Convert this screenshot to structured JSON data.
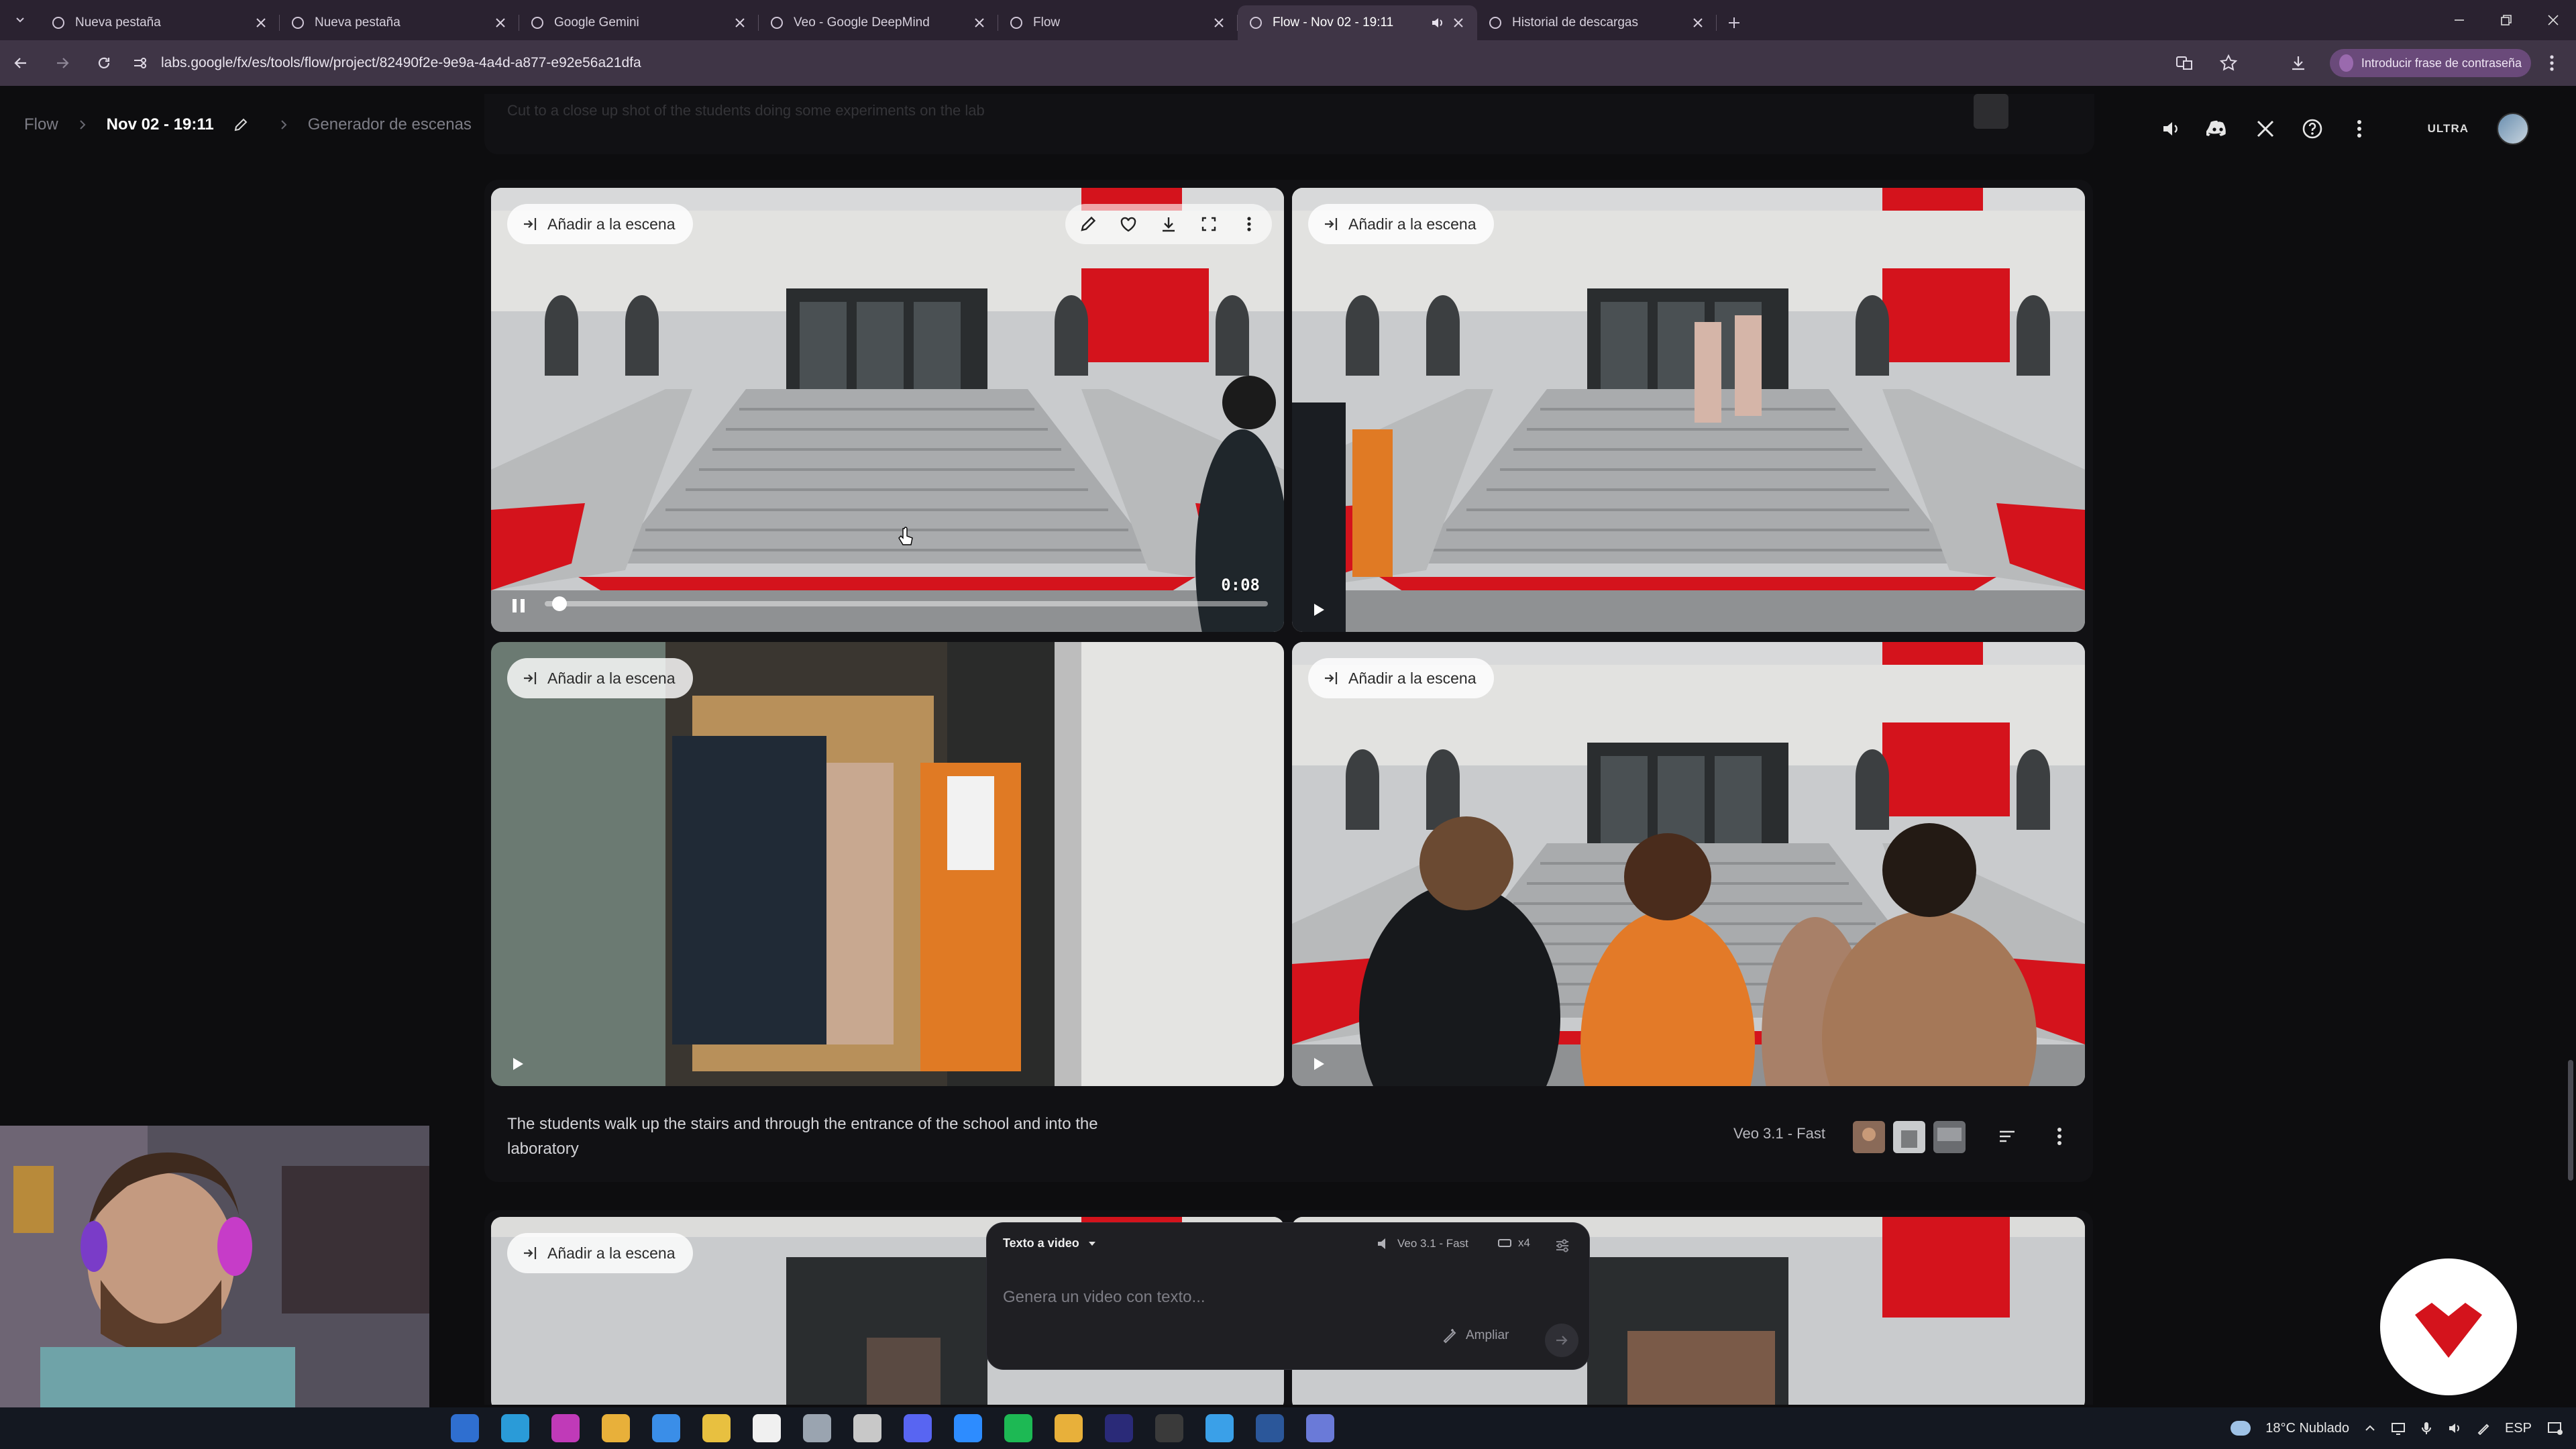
{
  "browser": {
    "tabs": [
      {
        "title": "Nueva pestaña",
        "icon": "globe-icon",
        "active": false
      },
      {
        "title": "Nueva pestaña",
        "icon": "globe-icon",
        "active": false
      },
      {
        "title": "Google Gemini",
        "icon": "gemini-icon",
        "active": false
      },
      {
        "title": "Veo - Google DeepMind",
        "icon": "deepmind-icon",
        "active": false
      },
      {
        "title": "Flow",
        "icon": "flow-icon",
        "active": false
      },
      {
        "title": "Flow - Nov 02 - 19:11",
        "icon": "flow-icon",
        "active": true,
        "audio": true
      },
      {
        "title": "Historial de descargas",
        "icon": "download-icon",
        "active": false
      }
    ],
    "url": "labs.google/fx/es/tools/flow/project/82490f2e-9e9a-4a4d-a877-e92e56a21dfa",
    "password_chip": "Introducir frase de contraseña"
  },
  "header": {
    "breadcrumb_root": "Flow",
    "project_name": "Nov 02 - 19:11",
    "section": "Generador de escenas",
    "plan_badge": "ULTRA",
    "icons": [
      "volume-icon",
      "discord-icon",
      "x-icon",
      "help-icon",
      "more-vert-icon"
    ]
  },
  "ghost_prompt": "Cut to a close up shot of the students doing some experiments on the lab",
  "clips": [
    {
      "chip": "Añadir a la escena",
      "playing": true,
      "timecode": "0:08",
      "progress": 0.02
    },
    {
      "chip": "Añadir a la escena",
      "playing": false
    },
    {
      "chip": "Añadir a la escena",
      "playing": false
    },
    {
      "chip": "Añadir a la escena",
      "playing": false
    }
  ],
  "card": {
    "description": "The students walk up the stairs and through the entrance of the school and into the laboratory",
    "model": "Veo 3.1 - Fast"
  },
  "card2": {
    "clips": [
      {
        "chip": "Añadir a la escena"
      },
      {
        "chip": ""
      }
    ]
  },
  "composer": {
    "mode": "Texto a video",
    "model": "Veo 3.1 - Fast",
    "count": "x4",
    "placeholder": "Genera un video con texto...",
    "expand_label": "Ampliar"
  },
  "taskbar": {
    "weather": "18°C Nublado",
    "language": "ESP",
    "apps": [
      "outlook-icon",
      "edge-icon",
      "app-icon",
      "chrome-icon",
      "calendar-icon",
      "explorer-icon",
      "notion-icon",
      "copy-icon",
      "task-icon",
      "discord-icon",
      "zoom-icon",
      "spotify-icon",
      "chrome-icon",
      "premiere-icon",
      "obs-icon",
      "photos-icon",
      "word-icon",
      "calc-icon"
    ]
  },
  "colors": {
    "accent_red": "#d4131c",
    "app_bg": "#0d0d0f",
    "card_bg": "#111114",
    "chrome_bg": "#3f3546"
  }
}
